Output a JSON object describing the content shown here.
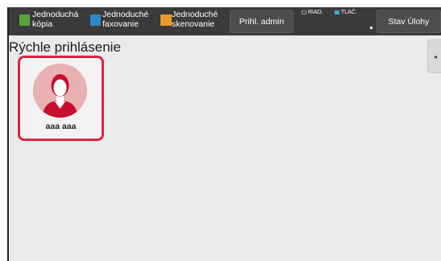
{
  "topbar": {
    "shortcuts": [
      {
        "label": "Jednoduchá kópia",
        "icon": "copy-icon",
        "color": "#5aa33a"
      },
      {
        "label": "Jednoduché faxovanie",
        "icon": "fax-icon",
        "color": "#2f86c8"
      },
      {
        "label": "Jednoduché skenovanie",
        "icon": "scan-icon",
        "color": "#e99a2a"
      }
    ],
    "admin_button": "Prihl. admin",
    "status_riad": "RIAD.",
    "status_tlac": "TLAČ.",
    "job_status_button": "Stav Úlohy"
  },
  "main": {
    "title": "Rýchle prihlásenie",
    "users": [
      {
        "name": "aaa aaa",
        "avatar": "user-avatar-icon",
        "selected": true
      }
    ]
  },
  "colors": {
    "topbar": "#3a3a3a",
    "selection": "#d9263f",
    "avatar_bg": "#e9b1b1",
    "avatar_figure": "#c8102e"
  }
}
